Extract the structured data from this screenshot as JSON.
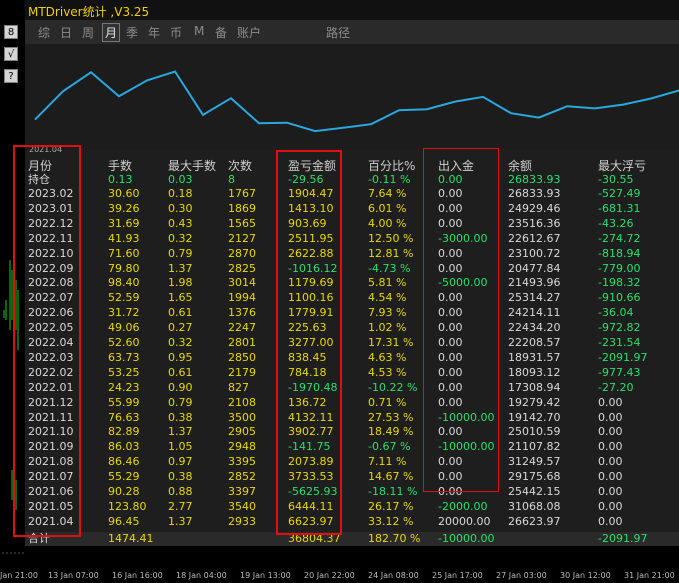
{
  "window": {
    "title": "MTDriver统计 ,V3.25"
  },
  "left_buttons": [
    "8",
    "√",
    "?"
  ],
  "tabs": [
    {
      "label": "综",
      "active": false
    },
    {
      "label": "日",
      "active": false
    },
    {
      "label": "周",
      "active": false
    },
    {
      "label": "月",
      "active": true
    },
    {
      "label": "季",
      "active": false
    },
    {
      "label": "年",
      "active": false
    },
    {
      "label": "币",
      "active": false
    },
    {
      "label": "M",
      "active": false
    },
    {
      "label": "备",
      "active": false
    },
    {
      "label": "账户",
      "active": false
    },
    {
      "label": "路径",
      "active": false
    }
  ],
  "chart": {
    "start_label": "2021.04",
    "line_color": "#29a8e0"
  },
  "headers": [
    "月份",
    "手数",
    "最大手数",
    "次数",
    "盈亏金额",
    "百分比%",
    "出入金",
    "余额",
    "最大浮亏"
  ],
  "holding_row": [
    "持仓",
    "0.13",
    "0.03",
    "8",
    "-29.56",
    "-0.11 %",
    "0.00",
    "26833.93",
    "-30.55"
  ],
  "rows": [
    [
      "2023.02",
      "30.60",
      "0.18",
      "1767",
      "1904.47",
      "7.64 %",
      "0.00",
      "26833.93",
      "-527.49"
    ],
    [
      "2023.01",
      "39.26",
      "0.30",
      "1869",
      "1413.10",
      "6.01 %",
      "0.00",
      "24929.46",
      "-681.31"
    ],
    [
      "2022.12",
      "31.69",
      "0.43",
      "1565",
      "903.69",
      "4.00 %",
      "0.00",
      "23516.36",
      "-43.26"
    ],
    [
      "2022.11",
      "41.93",
      "0.32",
      "2127",
      "2511.95",
      "12.50 %",
      "-3000.00",
      "22612.67",
      "-274.72"
    ],
    [
      "2022.10",
      "71.60",
      "0.79",
      "2870",
      "2622.88",
      "12.81 %",
      "0.00",
      "23100.72",
      "-818.94"
    ],
    [
      "2022.09",
      "79.80",
      "1.37",
      "2825",
      "-1016.12",
      "-4.73 %",
      "0.00",
      "20477.84",
      "-779.00"
    ],
    [
      "2022.08",
      "98.40",
      "1.98",
      "3014",
      "1179.69",
      "5.81 %",
      "-5000.00",
      "21493.96",
      "-198.32"
    ],
    [
      "2022.07",
      "52.59",
      "1.65",
      "1994",
      "1100.16",
      "4.54 %",
      "0.00",
      "25314.27",
      "-910.66"
    ],
    [
      "2022.06",
      "31.72",
      "0.61",
      "1376",
      "1779.91",
      "7.93 %",
      "0.00",
      "24214.11",
      "-36.04"
    ],
    [
      "2022.05",
      "49.06",
      "0.27",
      "2247",
      "225.63",
      "1.02 %",
      "0.00",
      "22434.20",
      "-972.82"
    ],
    [
      "2022.04",
      "52.60",
      "0.32",
      "2801",
      "3277.00",
      "17.31 %",
      "0.00",
      "22208.57",
      "-231.54"
    ],
    [
      "2022.03",
      "63.73",
      "0.95",
      "2850",
      "838.45",
      "4.63 %",
      "0.00",
      "18931.57",
      "-2091.97"
    ],
    [
      "2022.02",
      "53.25",
      "0.61",
      "2179",
      "784.18",
      "4.53 %",
      "0.00",
      "18093.12",
      "-977.43"
    ],
    [
      "2022.01",
      "24.23",
      "0.90",
      "827",
      "-1970.48",
      "-10.22 %",
      "0.00",
      "17308.94",
      "-27.20"
    ],
    [
      "2021.12",
      "55.99",
      "0.79",
      "2108",
      "136.72",
      "0.71 %",
      "0.00",
      "19279.42",
      "0.00"
    ],
    [
      "2021.11",
      "76.63",
      "0.38",
      "3500",
      "4132.11",
      "27.53 %",
      "-10000.00",
      "19142.70",
      "0.00"
    ],
    [
      "2021.10",
      "82.89",
      "1.37",
      "2905",
      "3902.77",
      "18.49 %",
      "0.00",
      "25010.59",
      "0.00"
    ],
    [
      "2021.09",
      "86.03",
      "1.05",
      "2948",
      "-141.75",
      "-0.67 %",
      "-10000.00",
      "21107.82",
      "0.00"
    ],
    [
      "2021.08",
      "86.46",
      "0.97",
      "3395",
      "2073.89",
      "7.11 %",
      "0.00",
      "31249.57",
      "0.00"
    ],
    [
      "2021.07",
      "55.29",
      "0.38",
      "2852",
      "3733.53",
      "14.67 %",
      "0.00",
      "29175.68",
      "0.00"
    ],
    [
      "2021.06",
      "90.28",
      "0.88",
      "3397",
      "-5625.93",
      "-18.11 %",
      "0.00",
      "25442.15",
      "0.00"
    ],
    [
      "2021.05",
      "123.80",
      "2.77",
      "3540",
      "6444.11",
      "26.17 %",
      "-2000.00",
      "31068.08",
      "0.00"
    ],
    [
      "2021.04",
      "96.45",
      "1.37",
      "2933",
      "6623.97",
      "33.12 %",
      "20000.00",
      "26623.97",
      "0.00"
    ]
  ],
  "total_row": [
    "合计",
    "1474.41",
    "",
    "",
    "36804.37",
    "182.70 %",
    "-10000.00",
    "",
    "-2091.97"
  ],
  "equity_series": [
    20000,
    26623.97,
    31068.08,
    25442.15,
    29175.68,
    31249.57,
    21107.82,
    25010.59,
    19142.7,
    19279.42,
    17308.94,
    18093.12,
    18931.57,
    22208.57,
    22434.2,
    24214.11,
    25314.27,
    21493.96,
    20477.84,
    23100.72,
    22612.67,
    23516.36,
    24929.46,
    26833.93
  ],
  "xaxis_labels": [
    "Jan 21:00",
    "13 Jan 07:00",
    "16 Jan 16:00",
    "18 Jan 04:00",
    "19 Jan 13:00",
    "20 Jan 22:00",
    "24 Jan 08:00",
    "25 Jan 17:00",
    "27 Jan 03:00",
    "30 Jan 12:00",
    "31 Jan 21:00"
  ]
}
